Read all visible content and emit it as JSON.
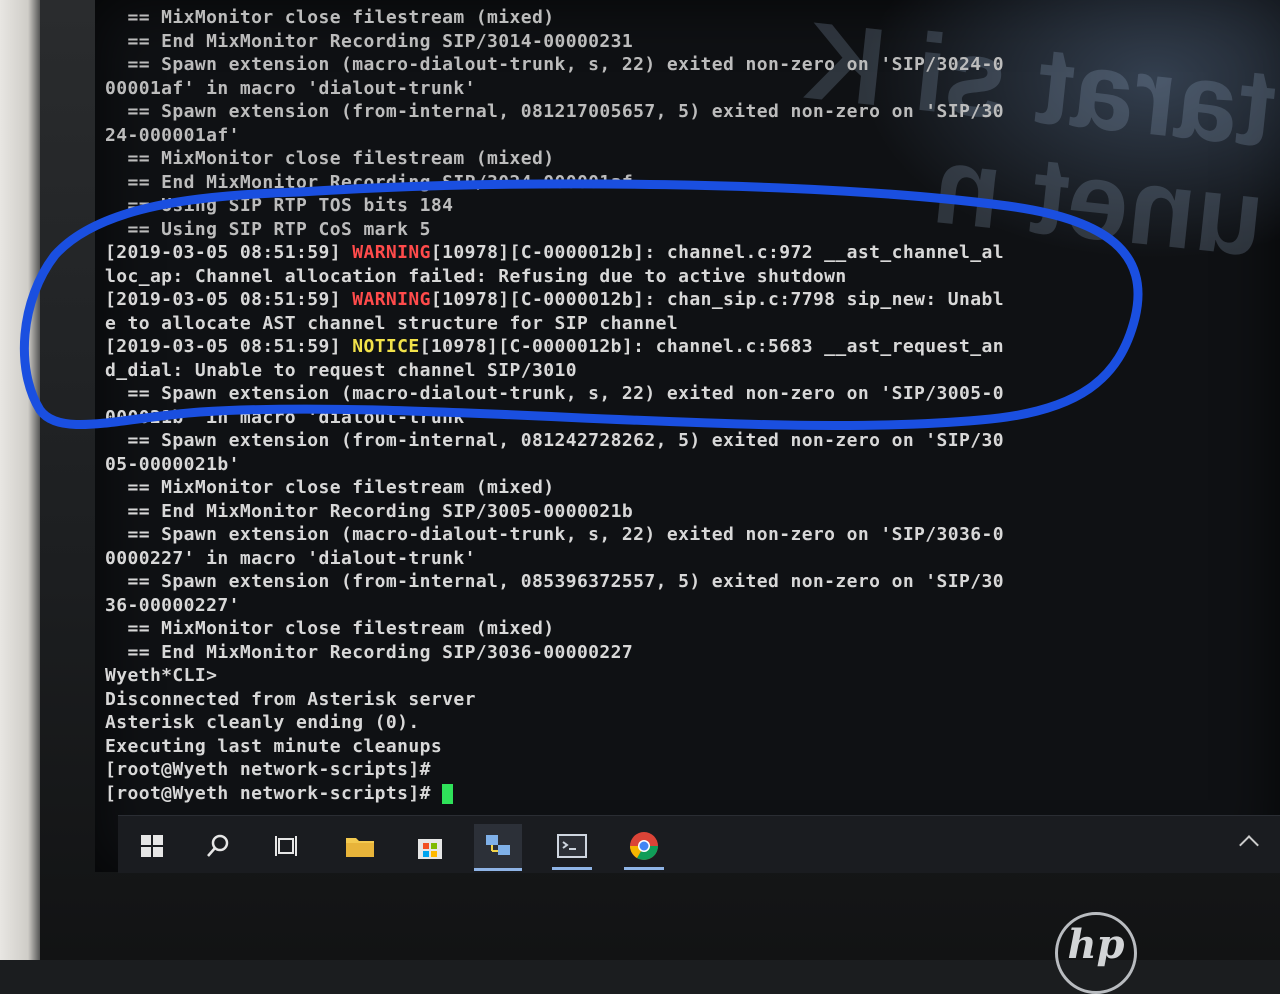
{
  "terminal": {
    "lines": [
      {
        "type": "plain",
        "text": "  == MixMonitor close filestream (mixed)",
        "dim": true
      },
      {
        "type": "plain",
        "text": "  == End MixMonitor Recording SIP/3014-00000231",
        "dim": true
      },
      {
        "type": "plain",
        "text": "  == Spawn extension (macro-dialout-trunk, s, 22) exited non-zero on 'SIP/3024-0",
        "dim": true
      },
      {
        "type": "plain",
        "text": "00001af' in macro 'dialout-trunk'",
        "dim": true
      },
      {
        "type": "plain",
        "text": "  == Spawn extension (from-internal, 081217005657, 5) exited non-zero on 'SIP/30",
        "dim": true
      },
      {
        "type": "plain",
        "text": "24-000001af'",
        "dim": true
      },
      {
        "type": "plain",
        "text": "  == MixMonitor close filestream (mixed)",
        "dim": true
      },
      {
        "type": "plain",
        "text": "  == End MixMonitor Recording SIP/3024-000001af",
        "dim": true
      },
      {
        "type": "plain",
        "text": "  == Using SIP RTP TOS bits 184",
        "dim": true
      },
      {
        "type": "plain",
        "text": "  == Using SIP RTP CoS mark 5",
        "dim": true
      },
      {
        "type": "log",
        "prefix": "[2019-03-05 08:51:59] ",
        "level": "WARNING",
        "level_class": "warn",
        "suffix": "[10978][C-0000012b]: channel.c:972 __ast_channel_al"
      },
      {
        "type": "plain",
        "text": "loc_ap: Channel allocation failed: Refusing due to active shutdown"
      },
      {
        "type": "log",
        "prefix": "[2019-03-05 08:51:59] ",
        "level": "WARNING",
        "level_class": "warn",
        "suffix": "[10978][C-0000012b]: chan_sip.c:7798 sip_new: Unabl"
      },
      {
        "type": "plain",
        "text": "e to allocate AST channel structure for SIP channel"
      },
      {
        "type": "log",
        "prefix": "[2019-03-05 08:51:59] ",
        "level": "NOTICE",
        "level_class": "notice",
        "suffix": "[10978][C-0000012b]: channel.c:5683 __ast_request_an"
      },
      {
        "type": "plain",
        "text": "d_dial: Unable to request channel SIP/3010"
      },
      {
        "type": "plain",
        "text": "  == Spawn extension (macro-dialout-trunk, s, 22) exited non-zero on 'SIP/3005-0"
      },
      {
        "type": "plain",
        "text": "000021b' in macro 'dialout-trunk'"
      },
      {
        "type": "plain",
        "text": "  == Spawn extension (from-internal, 081242728262, 5) exited non-zero on 'SIP/30"
      },
      {
        "type": "plain",
        "text": "05-0000021b'"
      },
      {
        "type": "plain",
        "text": "  == MixMonitor close filestream (mixed)"
      },
      {
        "type": "plain",
        "text": "  == End MixMonitor Recording SIP/3005-0000021b"
      },
      {
        "type": "plain",
        "text": "  == Spawn extension (macro-dialout-trunk, s, 22) exited non-zero on 'SIP/3036-0"
      },
      {
        "type": "plain",
        "text": "0000227' in macro 'dialout-trunk'"
      },
      {
        "type": "plain",
        "text": "  == Spawn extension (from-internal, 085396372557, 5) exited non-zero on 'SIP/30"
      },
      {
        "type": "plain",
        "text": "36-00000227'"
      },
      {
        "type": "plain",
        "text": "  == MixMonitor close filestream (mixed)"
      },
      {
        "type": "plain",
        "text": "  == End MixMonitor Recording SIP/3036-00000227"
      },
      {
        "type": "plain",
        "text": "Wyeth*CLI>"
      },
      {
        "type": "plain",
        "text": "Disconnected from Asterisk server"
      },
      {
        "type": "plain",
        "text": "Asterisk cleanly ending (0)."
      },
      {
        "type": "plain",
        "text": "Executing last minute cleanups"
      },
      {
        "type": "plain",
        "text": "[root@Wyeth network-scripts]#"
      },
      {
        "type": "prompt",
        "text": "[root@Wyeth network-scripts]# "
      }
    ]
  },
  "reflection_text": "tarat si K\nunet n",
  "taskbar": {
    "items": [
      {
        "name": "start-button",
        "icon": "windows-icon"
      },
      {
        "name": "search-button",
        "icon": "search-icon"
      },
      {
        "name": "task-view-button",
        "icon": "task-view-icon"
      },
      {
        "name": "file-explorer-button",
        "icon": "folder-icon"
      },
      {
        "name": "store-button",
        "icon": "store-icon"
      },
      {
        "name": "network-app-button",
        "icon": "network-icon"
      },
      {
        "name": "terminal-app-button",
        "icon": "terminal-icon"
      },
      {
        "name": "chrome-button",
        "icon": "chrome-icon"
      }
    ]
  },
  "colors": {
    "warning": "#ff4b4b",
    "notice": "#f2e24a",
    "cursor": "#2fe25a",
    "annotation_oval": "#1a4fe0"
  },
  "brand": {
    "logo_text": "hp"
  }
}
